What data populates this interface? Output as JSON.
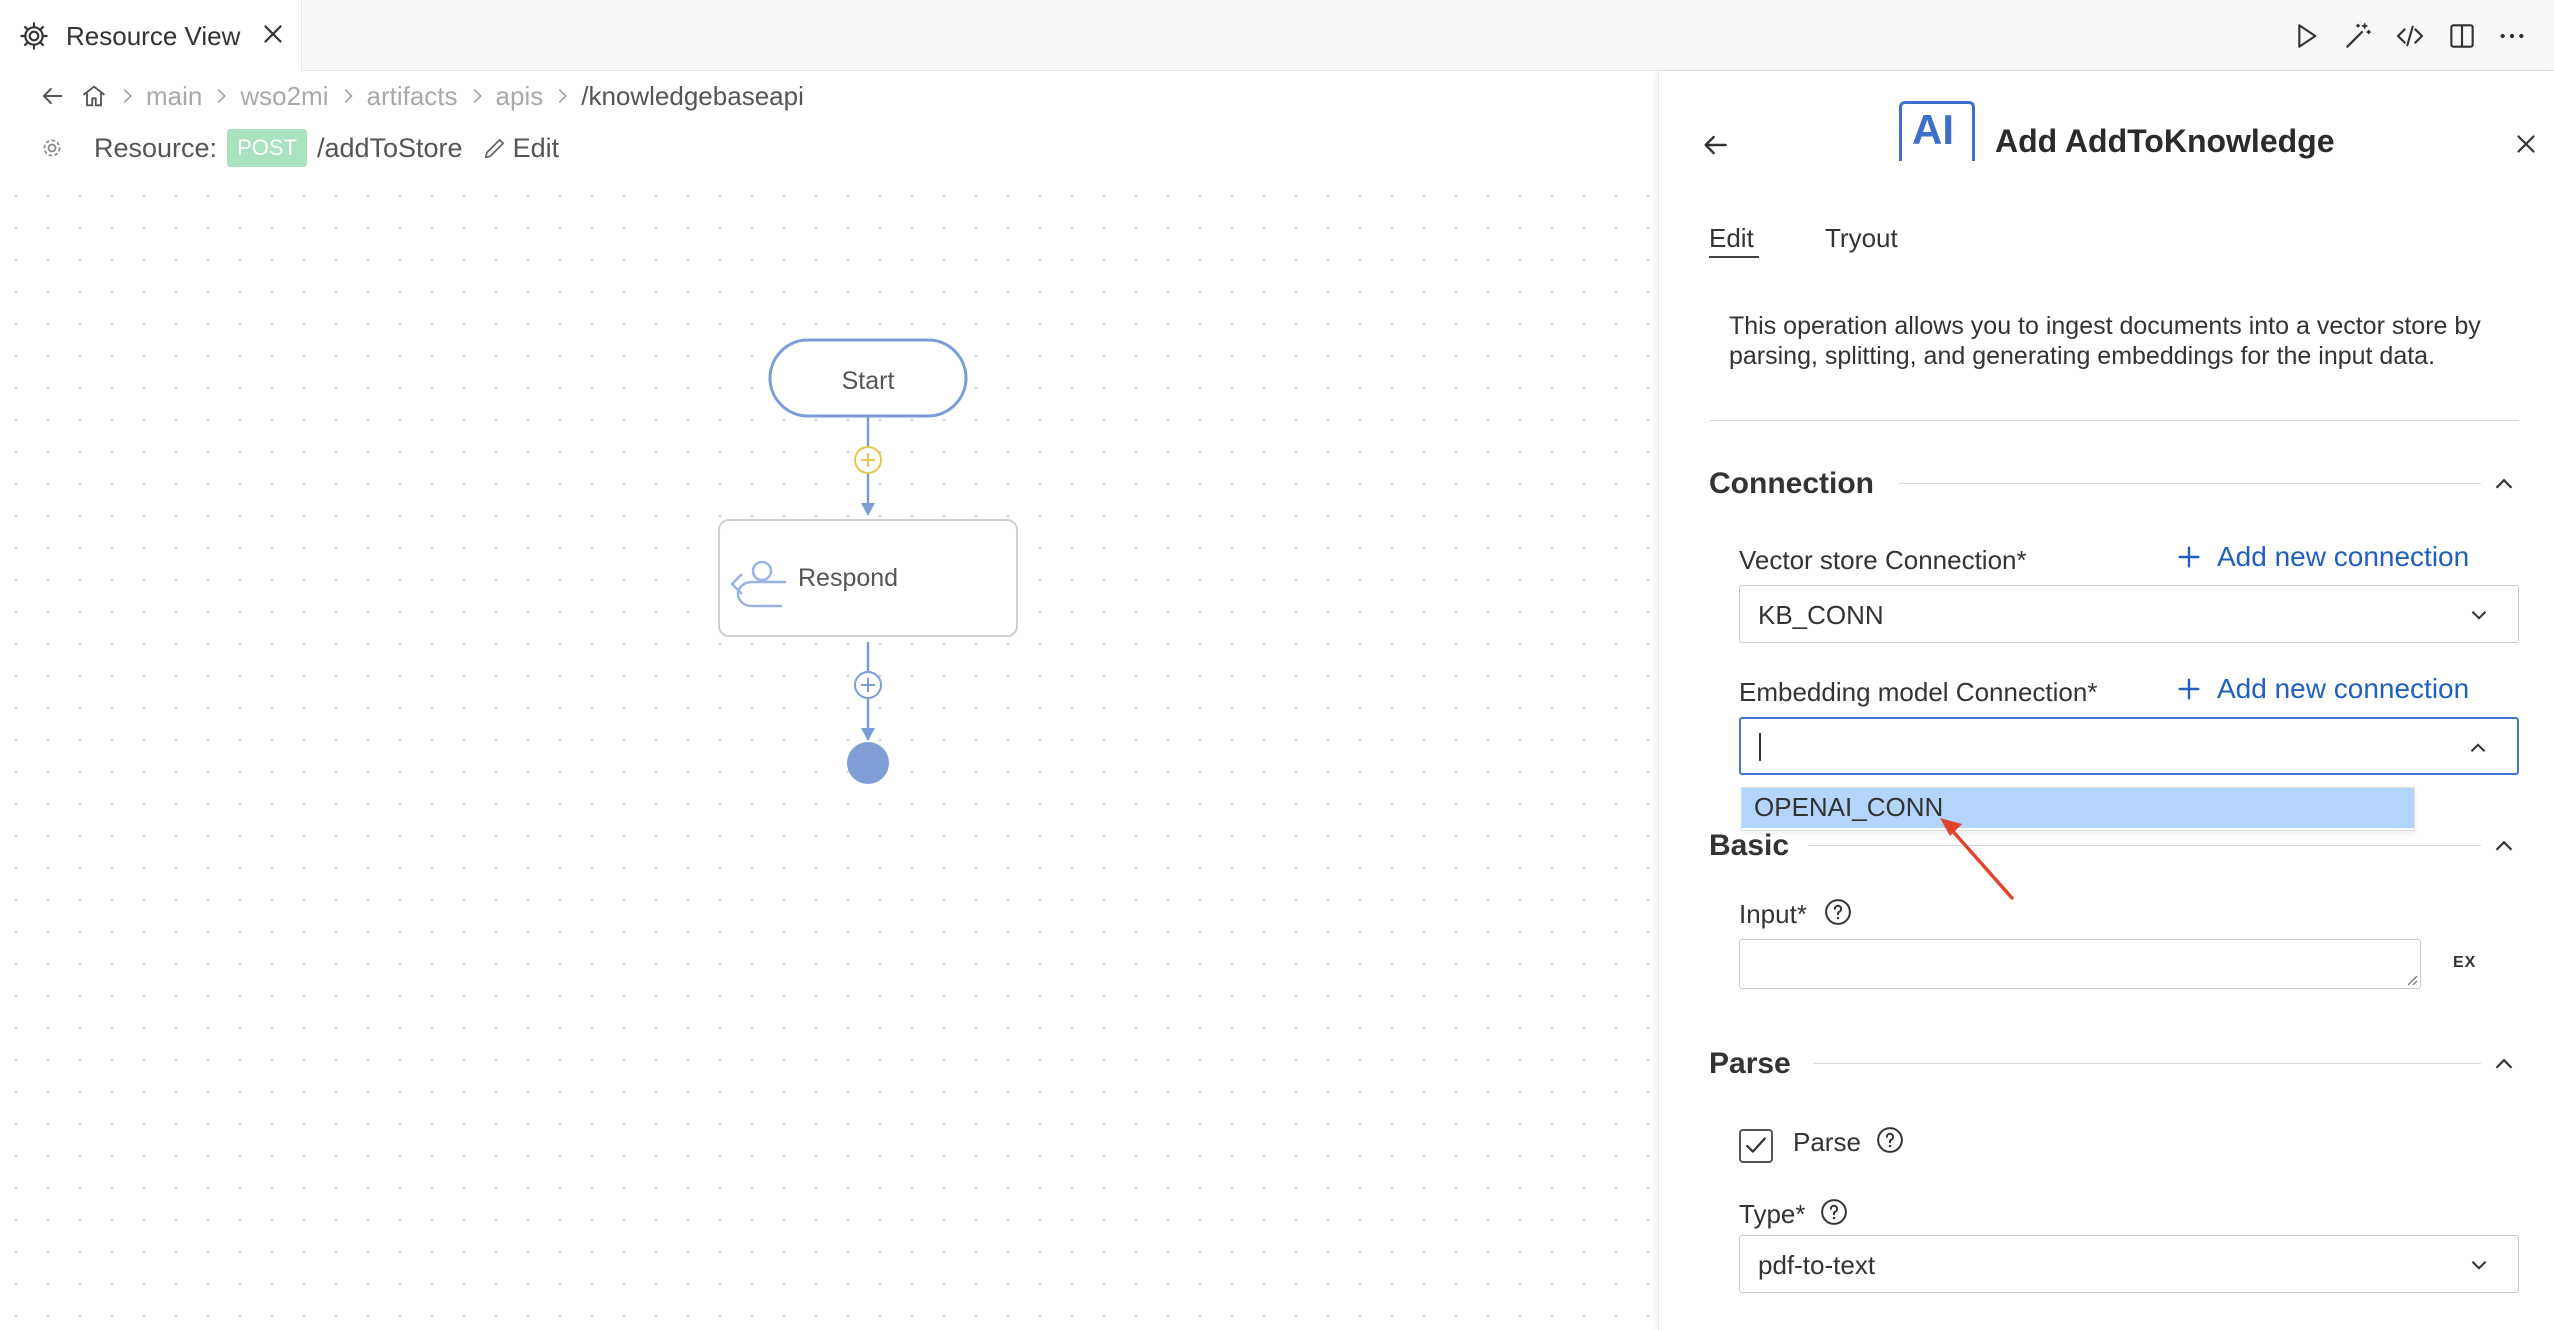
{
  "tab": {
    "label": "Resource View"
  },
  "breadcrumb": {
    "items": [
      "main",
      "wso2mi",
      "artifacts",
      "apis",
      "/knowledgebaseapi"
    ]
  },
  "resource": {
    "label": "Resource:",
    "method": "POST",
    "path": "/addToStore",
    "edit_label": "Edit"
  },
  "flow": {
    "start_label": "Start",
    "respond_label": "Respond"
  },
  "panel": {
    "icon_text": "AI",
    "title": "Add AddToKnowledge",
    "tabs": [
      "Edit",
      "Tryout"
    ],
    "description": "This operation allows you to ingest documents into a vector store by parsing, splitting, and generating embeddings for the input data.",
    "sections": {
      "connection": {
        "title": "Connection",
        "vector_store_label": "Vector store Connection*",
        "vector_store_value": "KB_CONN",
        "embedding_label": "Embedding model Connection*",
        "embedding_value": "",
        "add_connection_label": "Add new connection",
        "dropdown_options": [
          "OPENAI_CONN"
        ]
      },
      "basic": {
        "title": "Basic",
        "input_label": "Input*",
        "ex_label": "EX"
      },
      "parse": {
        "title": "Parse",
        "parse_label": "Parse",
        "parse_checked": true,
        "type_label": "Type*",
        "type_value": "pdf-to-text"
      }
    }
  },
  "colors": {
    "accent": "#3b77d6",
    "link": "#1f5fbf",
    "post_badge": "#a8e2bf",
    "highlight": "#b3d4fb",
    "flow": "#7a9cd9",
    "annotation_arrow": "#e0442f"
  }
}
